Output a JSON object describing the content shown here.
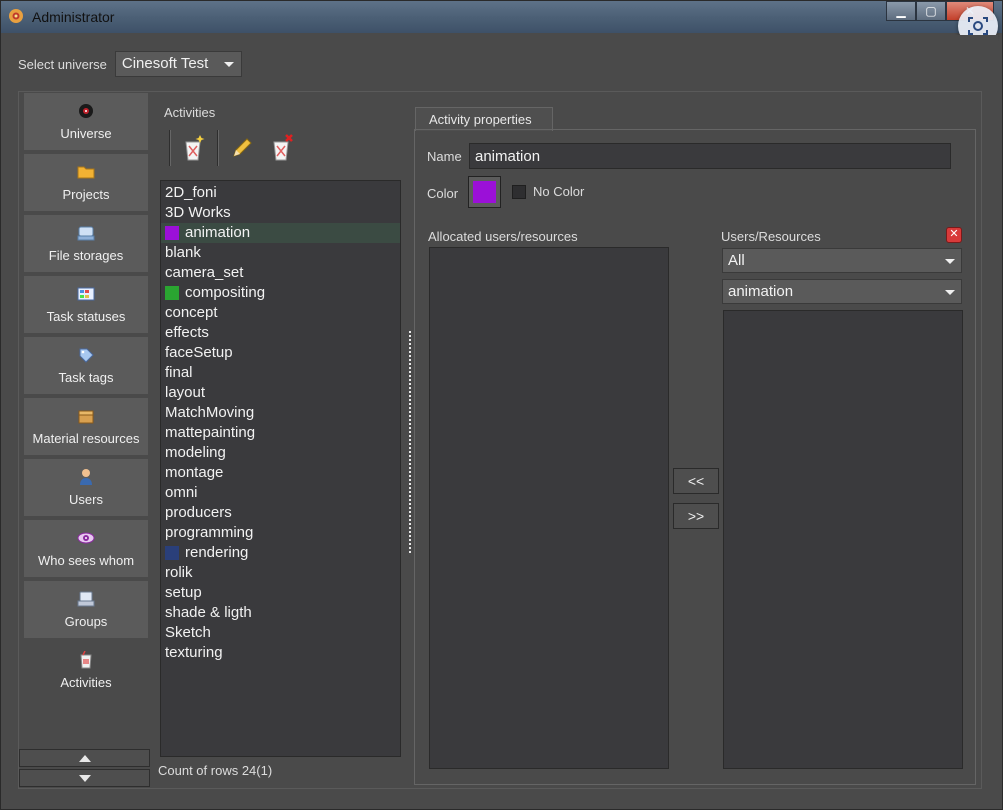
{
  "window": {
    "title": "Administrator"
  },
  "universe": {
    "label": "Select universe",
    "value": "Cinesoft Test"
  },
  "nav": {
    "items": [
      {
        "label": "Universe",
        "icon": "universe-icon"
      },
      {
        "label": "Projects",
        "icon": "folder-icon"
      },
      {
        "label": "File storages",
        "icon": "storage-icon"
      },
      {
        "label": "Task statuses",
        "icon": "status-grid-icon"
      },
      {
        "label": "Task tags",
        "icon": "tag-icon"
      },
      {
        "label": "Material resources",
        "icon": "box-icon"
      },
      {
        "label": "Users",
        "icon": "user-icon"
      },
      {
        "label": "Who sees whom",
        "icon": "eye-icon"
      },
      {
        "label": "Groups",
        "icon": "groups-icon"
      },
      {
        "label": "Activities",
        "icon": "activity-cup-icon"
      }
    ]
  },
  "activities": {
    "title": "Activities",
    "items": [
      {
        "label": "2D_foni",
        "color": ""
      },
      {
        "label": "3D Works",
        "color": ""
      },
      {
        "label": "animation",
        "color": "#9b10d8",
        "selected": true
      },
      {
        "label": "blank",
        "color": ""
      },
      {
        "label": "camera_set",
        "color": ""
      },
      {
        "label": "compositing",
        "color": "#2aa531"
      },
      {
        "label": "concept",
        "color": ""
      },
      {
        "label": "effects",
        "color": ""
      },
      {
        "label": "faceSetup",
        "color": ""
      },
      {
        "label": "final",
        "color": ""
      },
      {
        "label": "layout",
        "color": ""
      },
      {
        "label": "MatchMoving",
        "color": ""
      },
      {
        "label": "mattepainting",
        "color": ""
      },
      {
        "label": "modeling",
        "color": ""
      },
      {
        "label": "montage",
        "color": ""
      },
      {
        "label": "omni",
        "color": ""
      },
      {
        "label": "producers",
        "color": ""
      },
      {
        "label": "programming",
        "color": ""
      },
      {
        "label": "rendering",
        "color": "#2a3f7a"
      },
      {
        "label": "rolik",
        "color": ""
      },
      {
        "label": "setup",
        "color": ""
      },
      {
        "label": "shade & ligth",
        "color": ""
      },
      {
        "label": "Sketch",
        "color": ""
      },
      {
        "label": "texturing",
        "color": ""
      }
    ],
    "count": "Count of rows 24(1)"
  },
  "properties": {
    "tab": "Activity properties",
    "name_label": "Name",
    "name_value": "animation",
    "color_label": "Color",
    "color_value": "#9b10d8",
    "no_color_label": "No Color",
    "allocated_label": "Allocated users/resources",
    "move_left": "<<",
    "move_right": ">>",
    "users_label": "Users/Resources",
    "filter1": "All",
    "filter2": "animation"
  }
}
